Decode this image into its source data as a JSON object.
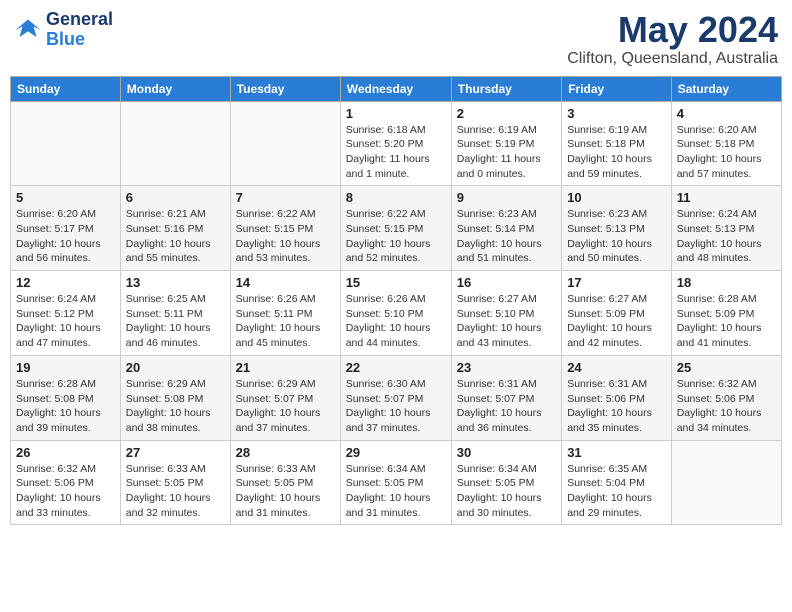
{
  "header": {
    "logo_line1": "General",
    "logo_line2": "Blue",
    "main_title": "May 2024",
    "subtitle": "Clifton, Queensland, Australia"
  },
  "calendar": {
    "days_of_week": [
      "Sunday",
      "Monday",
      "Tuesday",
      "Wednesday",
      "Thursday",
      "Friday",
      "Saturday"
    ],
    "weeks": [
      [
        {
          "day": "",
          "info": ""
        },
        {
          "day": "",
          "info": ""
        },
        {
          "day": "",
          "info": ""
        },
        {
          "day": "1",
          "info": "Sunrise: 6:18 AM\nSunset: 5:20 PM\nDaylight: 11 hours\nand 1 minute."
        },
        {
          "day": "2",
          "info": "Sunrise: 6:19 AM\nSunset: 5:19 PM\nDaylight: 11 hours\nand 0 minutes."
        },
        {
          "day": "3",
          "info": "Sunrise: 6:19 AM\nSunset: 5:18 PM\nDaylight: 10 hours\nand 59 minutes."
        },
        {
          "day": "4",
          "info": "Sunrise: 6:20 AM\nSunset: 5:18 PM\nDaylight: 10 hours\nand 57 minutes."
        }
      ],
      [
        {
          "day": "5",
          "info": "Sunrise: 6:20 AM\nSunset: 5:17 PM\nDaylight: 10 hours\nand 56 minutes."
        },
        {
          "day": "6",
          "info": "Sunrise: 6:21 AM\nSunset: 5:16 PM\nDaylight: 10 hours\nand 55 minutes."
        },
        {
          "day": "7",
          "info": "Sunrise: 6:22 AM\nSunset: 5:15 PM\nDaylight: 10 hours\nand 53 minutes."
        },
        {
          "day": "8",
          "info": "Sunrise: 6:22 AM\nSunset: 5:15 PM\nDaylight: 10 hours\nand 52 minutes."
        },
        {
          "day": "9",
          "info": "Sunrise: 6:23 AM\nSunset: 5:14 PM\nDaylight: 10 hours\nand 51 minutes."
        },
        {
          "day": "10",
          "info": "Sunrise: 6:23 AM\nSunset: 5:13 PM\nDaylight: 10 hours\nand 50 minutes."
        },
        {
          "day": "11",
          "info": "Sunrise: 6:24 AM\nSunset: 5:13 PM\nDaylight: 10 hours\nand 48 minutes."
        }
      ],
      [
        {
          "day": "12",
          "info": "Sunrise: 6:24 AM\nSunset: 5:12 PM\nDaylight: 10 hours\nand 47 minutes."
        },
        {
          "day": "13",
          "info": "Sunrise: 6:25 AM\nSunset: 5:11 PM\nDaylight: 10 hours\nand 46 minutes."
        },
        {
          "day": "14",
          "info": "Sunrise: 6:26 AM\nSunset: 5:11 PM\nDaylight: 10 hours\nand 45 minutes."
        },
        {
          "day": "15",
          "info": "Sunrise: 6:26 AM\nSunset: 5:10 PM\nDaylight: 10 hours\nand 44 minutes."
        },
        {
          "day": "16",
          "info": "Sunrise: 6:27 AM\nSunset: 5:10 PM\nDaylight: 10 hours\nand 43 minutes."
        },
        {
          "day": "17",
          "info": "Sunrise: 6:27 AM\nSunset: 5:09 PM\nDaylight: 10 hours\nand 42 minutes."
        },
        {
          "day": "18",
          "info": "Sunrise: 6:28 AM\nSunset: 5:09 PM\nDaylight: 10 hours\nand 41 minutes."
        }
      ],
      [
        {
          "day": "19",
          "info": "Sunrise: 6:28 AM\nSunset: 5:08 PM\nDaylight: 10 hours\nand 39 minutes."
        },
        {
          "day": "20",
          "info": "Sunrise: 6:29 AM\nSunset: 5:08 PM\nDaylight: 10 hours\nand 38 minutes."
        },
        {
          "day": "21",
          "info": "Sunrise: 6:29 AM\nSunset: 5:07 PM\nDaylight: 10 hours\nand 37 minutes."
        },
        {
          "day": "22",
          "info": "Sunrise: 6:30 AM\nSunset: 5:07 PM\nDaylight: 10 hours\nand 37 minutes."
        },
        {
          "day": "23",
          "info": "Sunrise: 6:31 AM\nSunset: 5:07 PM\nDaylight: 10 hours\nand 36 minutes."
        },
        {
          "day": "24",
          "info": "Sunrise: 6:31 AM\nSunset: 5:06 PM\nDaylight: 10 hours\nand 35 minutes."
        },
        {
          "day": "25",
          "info": "Sunrise: 6:32 AM\nSunset: 5:06 PM\nDaylight: 10 hours\nand 34 minutes."
        }
      ],
      [
        {
          "day": "26",
          "info": "Sunrise: 6:32 AM\nSunset: 5:06 PM\nDaylight: 10 hours\nand 33 minutes."
        },
        {
          "day": "27",
          "info": "Sunrise: 6:33 AM\nSunset: 5:05 PM\nDaylight: 10 hours\nand 32 minutes."
        },
        {
          "day": "28",
          "info": "Sunrise: 6:33 AM\nSunset: 5:05 PM\nDaylight: 10 hours\nand 31 minutes."
        },
        {
          "day": "29",
          "info": "Sunrise: 6:34 AM\nSunset: 5:05 PM\nDaylight: 10 hours\nand 31 minutes."
        },
        {
          "day": "30",
          "info": "Sunrise: 6:34 AM\nSunset: 5:05 PM\nDaylight: 10 hours\nand 30 minutes."
        },
        {
          "day": "31",
          "info": "Sunrise: 6:35 AM\nSunset: 5:04 PM\nDaylight: 10 hours\nand 29 minutes."
        },
        {
          "day": "",
          "info": ""
        }
      ]
    ]
  }
}
